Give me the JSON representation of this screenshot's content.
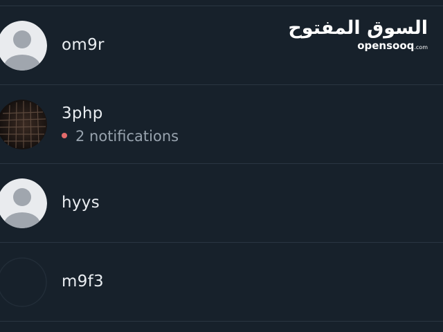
{
  "contacts": [
    {
      "name": "om9r",
      "avatar": "default-user"
    },
    {
      "name": "3php",
      "avatar": "photo",
      "notification_text": "2 notifications"
    },
    {
      "name": "hyys",
      "avatar": "default-user"
    },
    {
      "name": "m9f3",
      "avatar": "empty"
    }
  ],
  "watermark": {
    "arabic": "السوق المفتوح",
    "latin": "opensooq",
    "suffix": ".com"
  },
  "colors": {
    "background": "#17212b",
    "divider": "#2a3642",
    "name_text": "#e9edf1",
    "secondary_text": "#98a3ae",
    "notification_dot": "#e36b6b",
    "default_avatar_bg": "#e9ebee",
    "default_avatar_figure": "#a0a6ae"
  }
}
